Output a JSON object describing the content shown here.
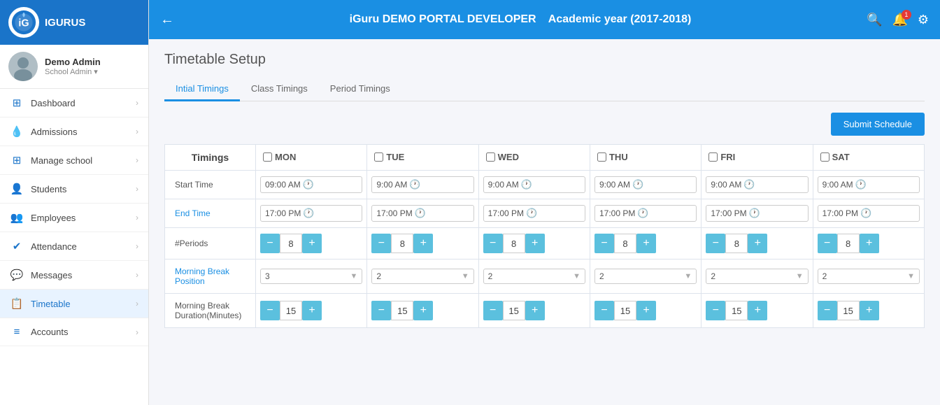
{
  "sidebar": {
    "logo_text": "IGURUS",
    "user": {
      "name": "Demo Admin",
      "role": "School Admin"
    },
    "items": [
      {
        "id": "dashboard",
        "label": "Dashboard",
        "icon": "⊞"
      },
      {
        "id": "admissions",
        "label": "Admissions",
        "icon": "💧"
      },
      {
        "id": "manage-school",
        "label": "Manage school",
        "icon": "⊞"
      },
      {
        "id": "students",
        "label": "Students",
        "icon": "👤"
      },
      {
        "id": "employees",
        "label": "Employees",
        "icon": "👥"
      },
      {
        "id": "attendance",
        "label": "Attendance",
        "icon": "✔"
      },
      {
        "id": "messages",
        "label": "Messages",
        "icon": "💬"
      },
      {
        "id": "timetable",
        "label": "Timetable",
        "icon": "📋"
      },
      {
        "id": "accounts",
        "label": "Accounts",
        "icon": "≡"
      }
    ]
  },
  "header": {
    "title": "iGuru DEMO PORTAL DEVELOPER",
    "academic_year": "Academic year (2017-2018)",
    "back_label": "←"
  },
  "page": {
    "title": "Timetable Setup",
    "tabs": [
      {
        "id": "initial",
        "label": "Intial Timings",
        "active": true
      },
      {
        "id": "class",
        "label": "Class Timings",
        "active": false
      },
      {
        "id": "period",
        "label": "Period Timings",
        "active": false
      }
    ],
    "submit_label": "Submit Schedule"
  },
  "table": {
    "timings_header": "Timings",
    "days": [
      "MON",
      "TUE",
      "WED",
      "THU",
      "FRI",
      "SAT"
    ],
    "rows": [
      {
        "label": "Start Time",
        "label_type": "normal",
        "type": "time",
        "values": [
          "09:00 AM",
          "9:00 AM",
          "9:00 AM",
          "9:00 AM",
          "9:00 AM",
          "9:00 AM"
        ]
      },
      {
        "label": "End Time",
        "label_type": "blue",
        "type": "time",
        "values": [
          "17:00 PM",
          "17:00 PM",
          "17:00 PM",
          "17:00 PM",
          "17:00 PM",
          "17:00 PM"
        ]
      },
      {
        "label": "#Periods",
        "label_type": "normal",
        "type": "counter",
        "values": [
          8,
          8,
          8,
          8,
          8,
          8
        ]
      },
      {
        "label": "Morning Break Position",
        "label_type": "blue",
        "type": "dropdown",
        "values": [
          3,
          2,
          2,
          2,
          2,
          2
        ]
      },
      {
        "label": "Morning Break Duration(Minutes)",
        "label_type": "normal",
        "type": "counter",
        "values": [
          15,
          15,
          15,
          15,
          15,
          15
        ]
      }
    ]
  }
}
